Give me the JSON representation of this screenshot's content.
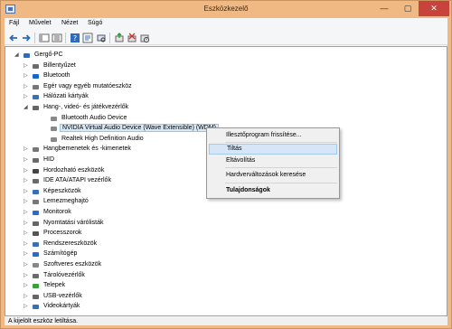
{
  "window": {
    "title": "Eszközkezelő",
    "minimize": "—",
    "maximize": "▢",
    "close": "✕"
  },
  "menu": [
    "Fájl",
    "Művelet",
    "Nézet",
    "Súgó"
  ],
  "tree": {
    "root": "Gergő-PC",
    "items": [
      {
        "label": "Billentyűzet",
        "icon": "keyboard-icon",
        "color": "#6a6a6a"
      },
      {
        "label": "Bluetooth",
        "icon": "bluetooth-icon",
        "color": "#1a64c8"
      },
      {
        "label": "Egér vagy egyéb mutatóeszköz",
        "icon": "mouse-icon",
        "color": "#777777"
      },
      {
        "label": "Hálózati kártyák",
        "icon": "network-adapter-icon",
        "color": "#3a6fb0"
      },
      {
        "label": "Hang-, videó- és játékvezérlők",
        "icon": "sound-icon",
        "color": "#666666"
      },
      {
        "label": "Bluetooth Audio Device",
        "icon": "speaker-icon",
        "color": "#888888"
      },
      {
        "label": "NVIDIA Virtual Audio Device (Wave Extensible) (WDM)",
        "icon": "speaker-icon",
        "color": "#888888"
      },
      {
        "label": "Realtek High Definition Audio",
        "icon": "speaker-icon",
        "color": "#888888"
      },
      {
        "label": "Hangbemenetek és -kimenetek",
        "icon": "audio-io-icon",
        "color": "#777777"
      },
      {
        "label": "HID",
        "icon": "hid-icon",
        "color": "#6a6a6a"
      },
      {
        "label": "Hordozható eszközök",
        "icon": "portable-device-icon",
        "color": "#444444"
      },
      {
        "label": "IDE ATA/ATAPI vezérlők",
        "icon": "ide-controller-icon",
        "color": "#6a6a6a"
      },
      {
        "label": "Képeszközök",
        "icon": "camera-icon",
        "color": "#3a6fb0"
      },
      {
        "label": "Lemezmeghajtó",
        "icon": "disk-drive-icon",
        "color": "#777777"
      },
      {
        "label": "Monitorok",
        "icon": "monitor-icon",
        "color": "#2e6bbf"
      },
      {
        "label": "Nyomtatási várólisták",
        "icon": "printer-icon",
        "color": "#666666"
      },
      {
        "label": "Processzorok",
        "icon": "processor-icon",
        "color": "#555555"
      },
      {
        "label": "Rendszereszközök",
        "icon": "system-device-icon",
        "color": "#3a6fb0"
      },
      {
        "label": "Számítógép",
        "icon": "computer-icon",
        "color": "#2e6bbf"
      },
      {
        "label": "Szoftveres eszközök",
        "icon": "software-device-icon",
        "color": "#888888"
      },
      {
        "label": "Tárolóvezérlők",
        "icon": "storage-controller-icon",
        "color": "#6a6a6a"
      },
      {
        "label": "Telepek",
        "icon": "battery-icon",
        "color": "#3aa03a"
      },
      {
        "label": "USB-vezérlők",
        "icon": "usb-icon",
        "color": "#666666"
      },
      {
        "label": "Videokártyák",
        "icon": "display-adapter-icon",
        "color": "#3a6fb0"
      }
    ]
  },
  "context_menu": {
    "items": [
      "Illesztőprogram frissítése...",
      "Tiltás",
      "Eltávolítás",
      "Hardverváltozások keresése",
      "Tulajdonságok"
    ]
  },
  "status": {
    "text": "A kijelölt eszköz letiltása."
  },
  "colors": {
    "accent": "#f0b882",
    "selection": "#d9e8f7",
    "close": "#c7433b"
  }
}
